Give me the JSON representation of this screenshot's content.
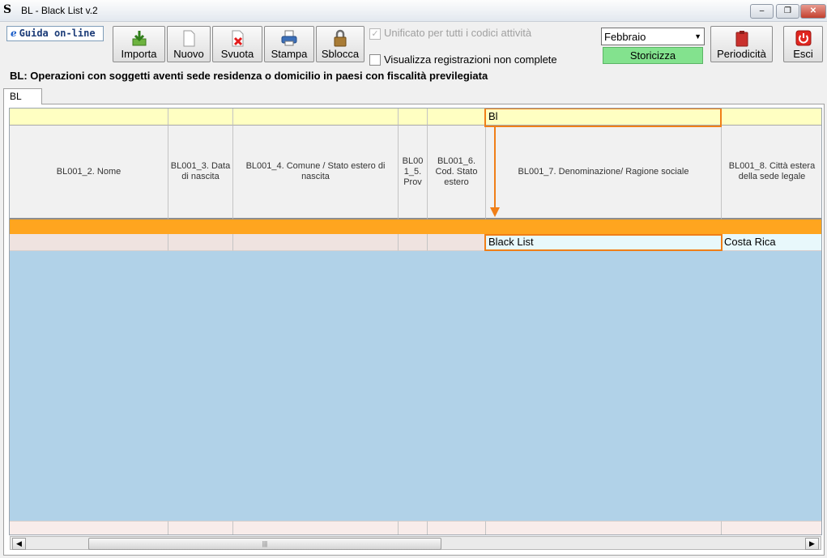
{
  "window": {
    "title": "BL - Black List v.2",
    "app_glyph": "S",
    "minimize_glyph": "‒",
    "restore_glyph": "❐",
    "close_glyph": "✕"
  },
  "toolbar": {
    "guida_glyph": "e",
    "guida_label": "Guida on-line",
    "buttons": [
      {
        "label": "Importa",
        "icon": "import-icon"
      },
      {
        "label": "Nuovo",
        "icon": "new-document-icon"
      },
      {
        "label": "Svuota",
        "icon": "clear-document-icon"
      },
      {
        "label": "Stampa",
        "icon": "printer-icon"
      },
      {
        "label": "Sblocca",
        "icon": "padlock-icon"
      }
    ],
    "checkbox_unificato": {
      "label": "Unificato per tutti i codici attività",
      "checked": true,
      "disabled": true,
      "mark": "✓"
    },
    "checkbox_visualizza": {
      "label": "Visualizza registrazioni non complete",
      "checked": false
    },
    "month_select": {
      "value": "Febbraio",
      "arrow": "▼"
    },
    "storicizza_label": "Storicizza",
    "periodicita_label": "Periodicità",
    "esci_label": "Esci",
    "colors": {
      "storicizza": "#83e28e",
      "highlight": "#f07f18",
      "band": "#ffa51f",
      "grid_bg": "#b1d2e8"
    }
  },
  "page_title": "BL: Operazioni con soggetti aventi sede residenza o domicilio in paesi con fiscalità previlegiata",
  "tabs": [
    {
      "label": "BL",
      "active": true
    }
  ],
  "grid": {
    "filter_row": {
      "denominazione": "Bl"
    },
    "headers": [
      "BL001_2. Nome",
      "BL001_3. Data di nascita",
      "BL001_4. Comune / Stato estero di nascita",
      "BL00 1_5. Prov",
      "BL001_6. Cod. Stato estero",
      "BL001_7. Denominazione/ Ragione sociale",
      "BL001_8. Città estera della sede legale"
    ],
    "rows": [
      {
        "denominazione": "Black List",
        "citta": "Costa Rica"
      }
    ]
  },
  "scrollbar": {
    "left_arrow": "◀",
    "right_arrow": "▶",
    "thumb_grip": "|||"
  }
}
